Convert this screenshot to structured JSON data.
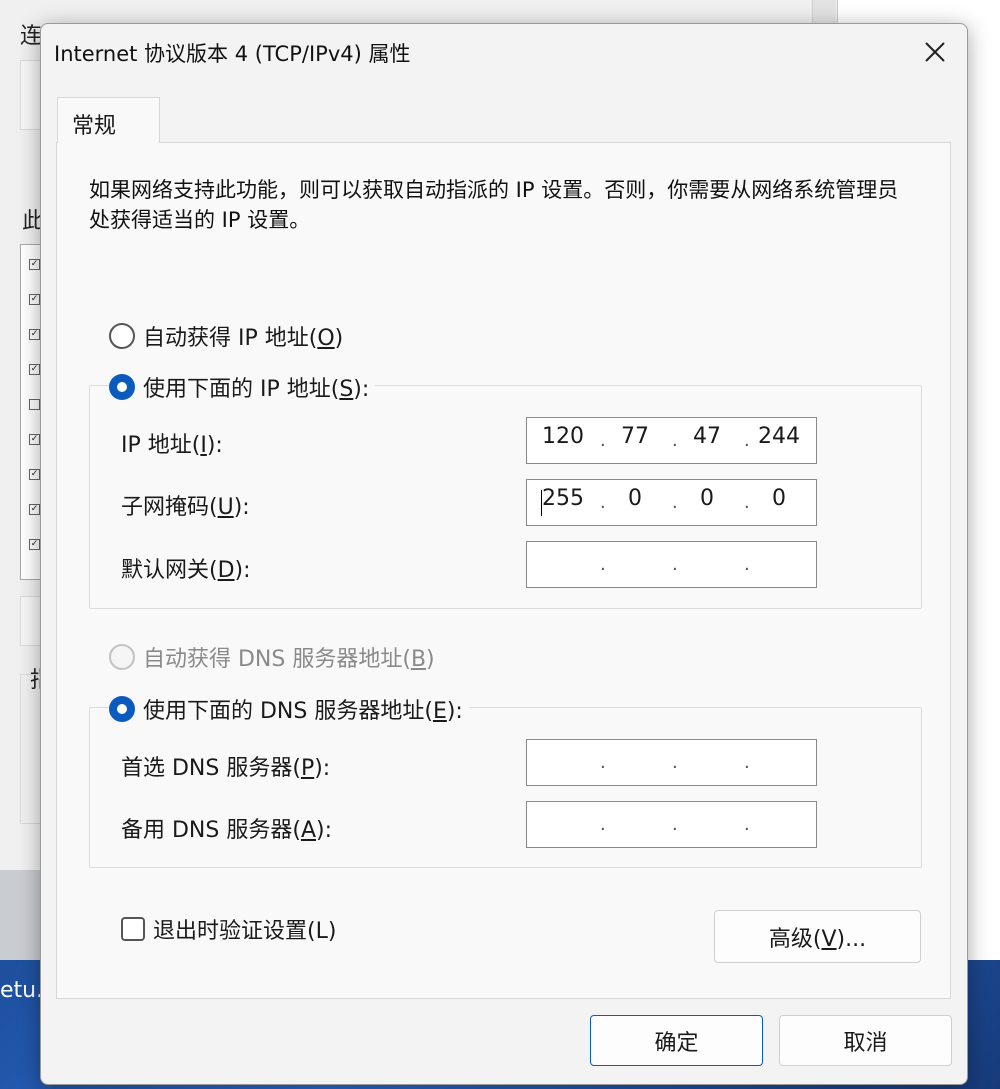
{
  "background": {
    "title_fragment": "连",
    "label_fragment": "此",
    "label_fragment2": "指",
    "taskbar_text": "etu."
  },
  "dialog": {
    "title": "Internet 协议版本 4 (TCP/IPv4) 属性",
    "tab": "常规",
    "description": "如果网络支持此功能，则可以获取自动指派的 IP 设置。否则，你需要从网络系统管理员处获得适当的 IP 设置。",
    "ip_section": {
      "auto_option": {
        "text": "自动获得 IP 地址(",
        "key": "O",
        "end": ")",
        "checked": false
      },
      "manual_option": {
        "text": "使用下面的 IP 地址(",
        "key": "S",
        "end": "):",
        "checked": true
      },
      "fields": [
        {
          "label": "IP 地址(",
          "key": "I",
          "end": "):",
          "octets": [
            "120",
            "77",
            "47",
            "244"
          ]
        },
        {
          "label": "子网掩码(",
          "key": "U",
          "end": "):",
          "octets": [
            "255",
            "0",
            "0",
            "0"
          ]
        },
        {
          "label": "默认网关(",
          "key": "D",
          "end": "):",
          "octets": [
            "",
            "",
            "",
            ""
          ]
        }
      ]
    },
    "dns_section": {
      "auto_option": {
        "text": "自动获得 DNS 服务器地址(",
        "key": "B",
        "end": ")",
        "checked": false,
        "disabled": true
      },
      "manual_option": {
        "text": "使用下面的 DNS 服务器地址(",
        "key": "E",
        "end": "):",
        "checked": true
      },
      "fields": [
        {
          "label": "首选 DNS 服务器(",
          "key": "P",
          "end": "):",
          "octets": [
            "",
            "",
            "",
            ""
          ]
        },
        {
          "label": "备用 DNS 服务器(",
          "key": "A",
          "end": "):",
          "octets": [
            "",
            "",
            "",
            ""
          ]
        }
      ]
    },
    "validate_checkbox": {
      "label": "退出时验证设置(L)",
      "checked": false
    },
    "advanced_button": {
      "text": "高级(",
      "key": "V",
      "end": ")..."
    },
    "ok_button": "确定",
    "cancel_button": "取消"
  }
}
